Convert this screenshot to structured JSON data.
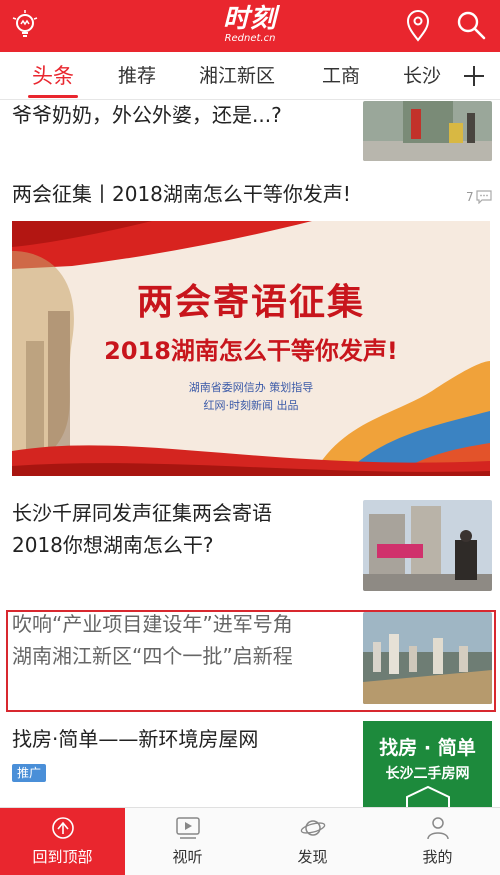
{
  "header": {
    "logo_main": "时刻",
    "logo_sub": "Rednet.cn",
    "accent_color": "#e9262e",
    "icons": [
      "bulb-icon",
      "location-pin-icon",
      "search-icon"
    ]
  },
  "tabs": [
    {
      "label": "头条",
      "active": true
    },
    {
      "label": "推荐",
      "active": false
    },
    {
      "label": "湘江新区",
      "active": false
    },
    {
      "label": "工商",
      "active": false
    },
    {
      "label": "长沙",
      "active": false
    }
  ],
  "feed": {
    "item1": {
      "title": "爷爷奶奶，外公外婆，还是...?"
    },
    "item2": {
      "title": "两会征集丨2018湖南怎么干等你发声!",
      "comment_count": "7",
      "banner": {
        "title": "两会寄语征集",
        "subtitle": "2018湖南怎么干等你发声!",
        "line1": "湖南省委网信办  策划指导",
        "line2": "红网·时刻新闻  出品"
      }
    },
    "item3": {
      "title_line1": "长沙千屏同发声征集两会寄语",
      "title_line2": "2018你想湖南怎么干?"
    },
    "item4": {
      "title_line1": "吹响“产业项目建设年”进军号角",
      "title_line2": "湖南湘江新区“四个一批”启新程"
    },
    "item5": {
      "title": "找房·简单——新环境房屋网",
      "tag": "推广",
      "ad_line1": "找房 · 简单",
      "ad_line2": "长沙二手房网"
    }
  },
  "bottom_nav": [
    {
      "label": "回到顶部",
      "icon": "back-to-top-icon",
      "active": true
    },
    {
      "label": "视听",
      "icon": "video-icon",
      "active": false
    },
    {
      "label": "发现",
      "icon": "planet-icon",
      "active": false
    },
    {
      "label": "我的",
      "icon": "user-icon",
      "active": false
    }
  ]
}
